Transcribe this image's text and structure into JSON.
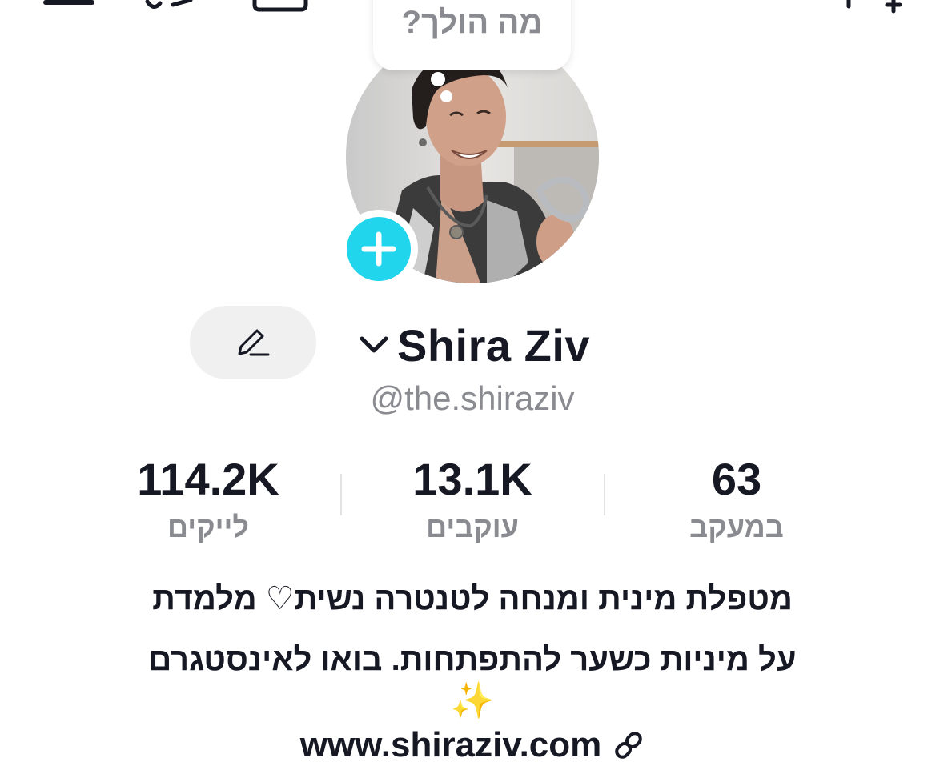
{
  "profile": {
    "status_bubble": "מה הולך?",
    "display_name": "Shira Ziv",
    "username": "@the.shiraziv",
    "edit_label": "",
    "stats": {
      "following": {
        "value": "63",
        "label": "במעקב"
      },
      "followers": {
        "value": "13.1K",
        "label": "עוקבים"
      },
      "likes": {
        "value": "114.2K",
        "label": "לייקים"
      }
    },
    "bio_line_1": "מטפלת מינית ומנחה לטנטרה נשית♡ מלמדת",
    "bio_line_2": "על מיניות כשער להתפתחות. בואו לאינסטגרם",
    "bio_sparkle": "✨",
    "website": "www.shiraziv.com"
  },
  "icons": {
    "top_left_1": "menu-icon",
    "top_left_2": "footprint-icon",
    "top_left_3": "calendar-icon",
    "top_right": "add-friend-icon",
    "avatar_add": "plus-icon",
    "edit": "pencil-icon",
    "switch_account": "chevron-down-icon",
    "link": "link-icon"
  },
  "colors": {
    "accent_cyan": "#20d5ec",
    "text_primary": "#161823",
    "text_secondary": "#8a8b91",
    "button_bg": "#f0f0f1"
  }
}
